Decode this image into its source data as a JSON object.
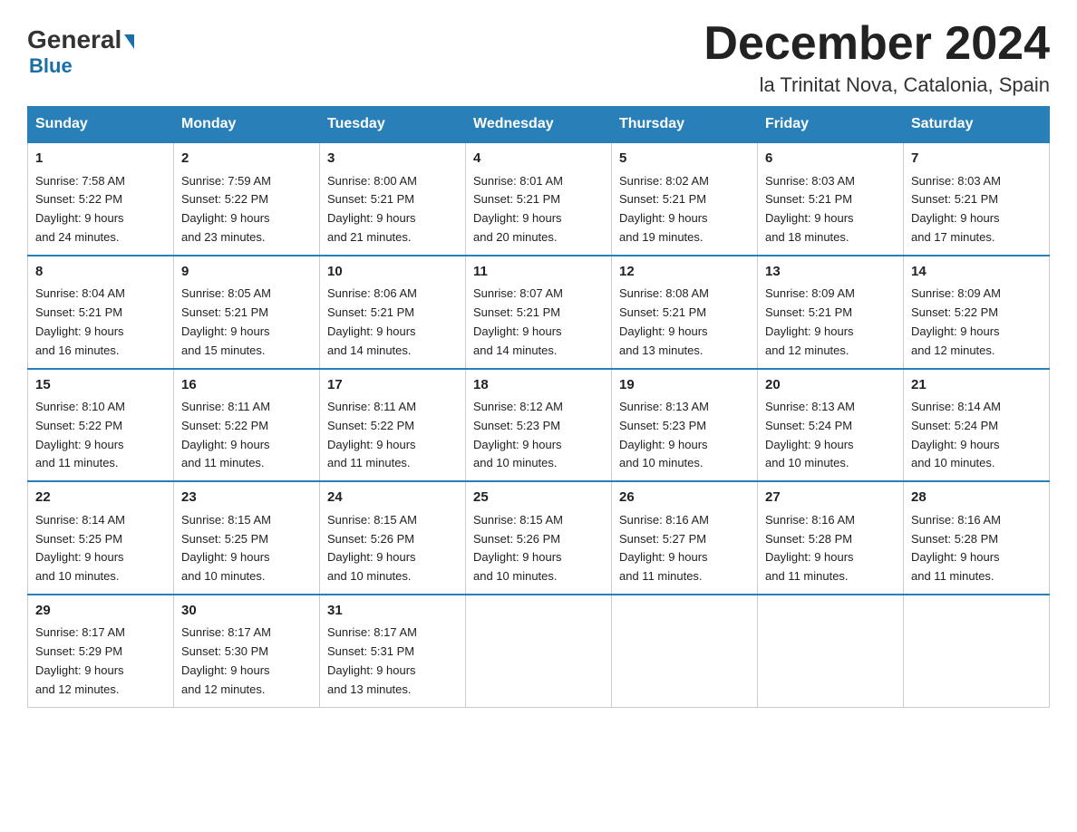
{
  "header": {
    "logo_general": "General",
    "logo_blue": "Blue",
    "month_title": "December 2024",
    "location": "la Trinitat Nova, Catalonia, Spain"
  },
  "days_of_week": [
    "Sunday",
    "Monday",
    "Tuesday",
    "Wednesday",
    "Thursday",
    "Friday",
    "Saturday"
  ],
  "weeks": [
    [
      {
        "day": "1",
        "sunrise": "7:58 AM",
        "sunset": "5:22 PM",
        "daylight": "9 hours and 24 minutes."
      },
      {
        "day": "2",
        "sunrise": "7:59 AM",
        "sunset": "5:22 PM",
        "daylight": "9 hours and 23 minutes."
      },
      {
        "day": "3",
        "sunrise": "8:00 AM",
        "sunset": "5:21 PM",
        "daylight": "9 hours and 21 minutes."
      },
      {
        "day": "4",
        "sunrise": "8:01 AM",
        "sunset": "5:21 PM",
        "daylight": "9 hours and 20 minutes."
      },
      {
        "day": "5",
        "sunrise": "8:02 AM",
        "sunset": "5:21 PM",
        "daylight": "9 hours and 19 minutes."
      },
      {
        "day": "6",
        "sunrise": "8:03 AM",
        "sunset": "5:21 PM",
        "daylight": "9 hours and 18 minutes."
      },
      {
        "day": "7",
        "sunrise": "8:03 AM",
        "sunset": "5:21 PM",
        "daylight": "9 hours and 17 minutes."
      }
    ],
    [
      {
        "day": "8",
        "sunrise": "8:04 AM",
        "sunset": "5:21 PM",
        "daylight": "9 hours and 16 minutes."
      },
      {
        "day": "9",
        "sunrise": "8:05 AM",
        "sunset": "5:21 PM",
        "daylight": "9 hours and 15 minutes."
      },
      {
        "day": "10",
        "sunrise": "8:06 AM",
        "sunset": "5:21 PM",
        "daylight": "9 hours and 14 minutes."
      },
      {
        "day": "11",
        "sunrise": "8:07 AM",
        "sunset": "5:21 PM",
        "daylight": "9 hours and 14 minutes."
      },
      {
        "day": "12",
        "sunrise": "8:08 AM",
        "sunset": "5:21 PM",
        "daylight": "9 hours and 13 minutes."
      },
      {
        "day": "13",
        "sunrise": "8:09 AM",
        "sunset": "5:21 PM",
        "daylight": "9 hours and 12 minutes."
      },
      {
        "day": "14",
        "sunrise": "8:09 AM",
        "sunset": "5:22 PM",
        "daylight": "9 hours and 12 minutes."
      }
    ],
    [
      {
        "day": "15",
        "sunrise": "8:10 AM",
        "sunset": "5:22 PM",
        "daylight": "9 hours and 11 minutes."
      },
      {
        "day": "16",
        "sunrise": "8:11 AM",
        "sunset": "5:22 PM",
        "daylight": "9 hours and 11 minutes."
      },
      {
        "day": "17",
        "sunrise": "8:11 AM",
        "sunset": "5:22 PM",
        "daylight": "9 hours and 11 minutes."
      },
      {
        "day": "18",
        "sunrise": "8:12 AM",
        "sunset": "5:23 PM",
        "daylight": "9 hours and 10 minutes."
      },
      {
        "day": "19",
        "sunrise": "8:13 AM",
        "sunset": "5:23 PM",
        "daylight": "9 hours and 10 minutes."
      },
      {
        "day": "20",
        "sunrise": "8:13 AM",
        "sunset": "5:24 PM",
        "daylight": "9 hours and 10 minutes."
      },
      {
        "day": "21",
        "sunrise": "8:14 AM",
        "sunset": "5:24 PM",
        "daylight": "9 hours and 10 minutes."
      }
    ],
    [
      {
        "day": "22",
        "sunrise": "8:14 AM",
        "sunset": "5:25 PM",
        "daylight": "9 hours and 10 minutes."
      },
      {
        "day": "23",
        "sunrise": "8:15 AM",
        "sunset": "5:25 PM",
        "daylight": "9 hours and 10 minutes."
      },
      {
        "day": "24",
        "sunrise": "8:15 AM",
        "sunset": "5:26 PM",
        "daylight": "9 hours and 10 minutes."
      },
      {
        "day": "25",
        "sunrise": "8:15 AM",
        "sunset": "5:26 PM",
        "daylight": "9 hours and 10 minutes."
      },
      {
        "day": "26",
        "sunrise": "8:16 AM",
        "sunset": "5:27 PM",
        "daylight": "9 hours and 11 minutes."
      },
      {
        "day": "27",
        "sunrise": "8:16 AM",
        "sunset": "5:28 PM",
        "daylight": "9 hours and 11 minutes."
      },
      {
        "day": "28",
        "sunrise": "8:16 AM",
        "sunset": "5:28 PM",
        "daylight": "9 hours and 11 minutes."
      }
    ],
    [
      {
        "day": "29",
        "sunrise": "8:17 AM",
        "sunset": "5:29 PM",
        "daylight": "9 hours and 12 minutes."
      },
      {
        "day": "30",
        "sunrise": "8:17 AM",
        "sunset": "5:30 PM",
        "daylight": "9 hours and 12 minutes."
      },
      {
        "day": "31",
        "sunrise": "8:17 AM",
        "sunset": "5:31 PM",
        "daylight": "9 hours and 13 minutes."
      },
      null,
      null,
      null,
      null
    ]
  ],
  "labels": {
    "sunrise": "Sunrise:",
    "sunset": "Sunset:",
    "daylight": "Daylight:"
  }
}
